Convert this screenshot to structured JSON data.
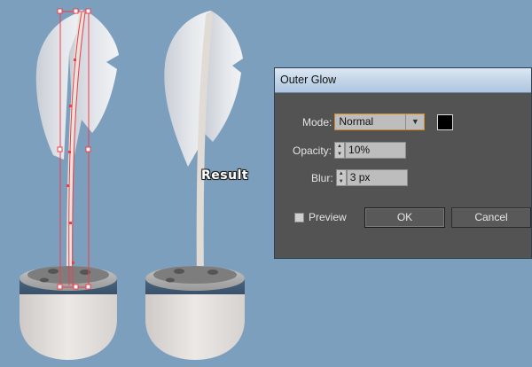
{
  "canvas": {
    "result_label": "Result"
  },
  "dialog": {
    "title": "Outer Glow",
    "mode": {
      "label": "Mode:",
      "value": "Normal",
      "swatch_color": "#000000"
    },
    "opacity": {
      "label": "Opacity:",
      "value": "10%"
    },
    "blur": {
      "label": "Blur:",
      "value": "3 px"
    },
    "preview": {
      "label": "Preview",
      "checked": false
    },
    "ok_label": "OK",
    "cancel_label": "Cancel"
  }
}
